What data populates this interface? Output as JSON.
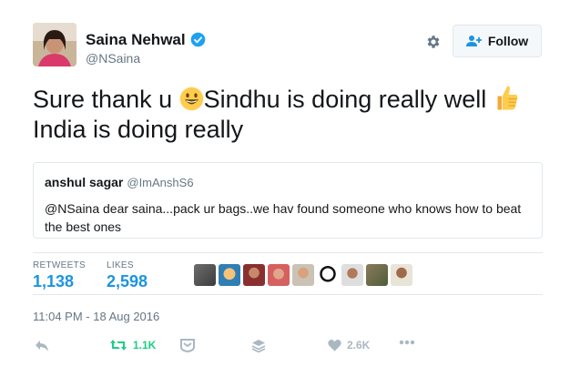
{
  "user": {
    "name": "Saina Nehwal",
    "handle": "@NSaina",
    "avatar_icon": "profile-photo"
  },
  "follow_label": "Follow",
  "tweet": {
    "text_part1": "Sure thank u ",
    "text_part2": "Sindhu is doing really well ",
    "text_part3": "India is doing really",
    "emoji1": "smiling-face-emoji",
    "emoji2": "thumbs-up-emoji"
  },
  "quoted": {
    "name": "anshul sagar",
    "handle": "@ImAnshS6",
    "text": "@NSaina dear saina...pack ur bags..we hav found someone who knows how to beat the best ones"
  },
  "stats": {
    "retweets_label": "RETWEETS",
    "retweets_value": "1,138",
    "likes_label": "LIKES",
    "likes_value": "2,598"
  },
  "timestamp": "11:04 PM - 18 Aug 2016",
  "actions": {
    "retweet_count": "1.1K",
    "like_count": "2.6K"
  },
  "colors": {
    "accent": "#1b95e0",
    "retweet_green": "#19cf86",
    "muted": "#657786",
    "icon_gray": "#aab8c2"
  }
}
